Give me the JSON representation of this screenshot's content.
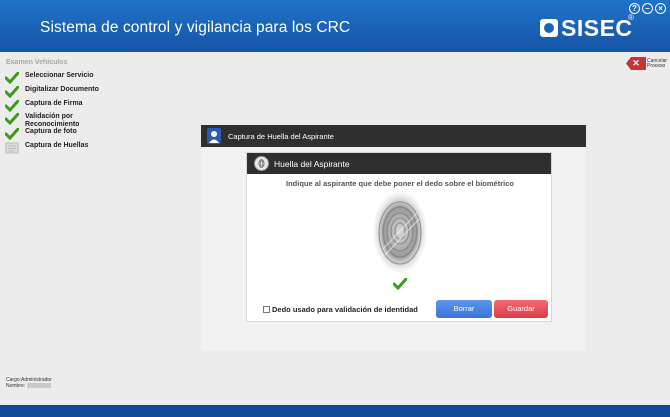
{
  "app": {
    "title": "Sistema de control y vigilancia para los CRC",
    "logo_text": "SISEC",
    "logo_reg": "®",
    "window_controls": [
      "?",
      "–",
      "×"
    ]
  },
  "sidebar": {
    "section_title": "Examen Vehiculos",
    "steps": [
      {
        "label": "Seleccionar Servicio",
        "status": "done"
      },
      {
        "label": "Digitalizar Documento",
        "status": "done"
      },
      {
        "label": "Captura de Firma",
        "status": "done"
      },
      {
        "label": "Validación por Reconocimiento",
        "status": "done"
      },
      {
        "label": "Captura de foto",
        "status": "done"
      },
      {
        "label": "Captura de Huellas",
        "status": "pending"
      }
    ]
  },
  "cancel": {
    "label": "Cancelar Proceso"
  },
  "panel": {
    "title": "Captura de Huella del Aspirante",
    "card_title": "Huella del Aspirante",
    "instruction": "Indique al aspirante que debe poner el dedo sobre el biométrico",
    "checkbox_label": "Dedo usado para validación de identidad",
    "checkbox_checked": false,
    "borrar_label": "Borrar",
    "guardar_label": "Guardar"
  },
  "footer": {
    "cargo_label": "Cargo:",
    "cargo_value": "Administrador",
    "nombre_label": "Nombre:"
  },
  "colors": {
    "header": "#1a62b5",
    "check_green": "#3d9a1c",
    "borrar": "#4a84e2",
    "guardar": "#e44a55"
  }
}
